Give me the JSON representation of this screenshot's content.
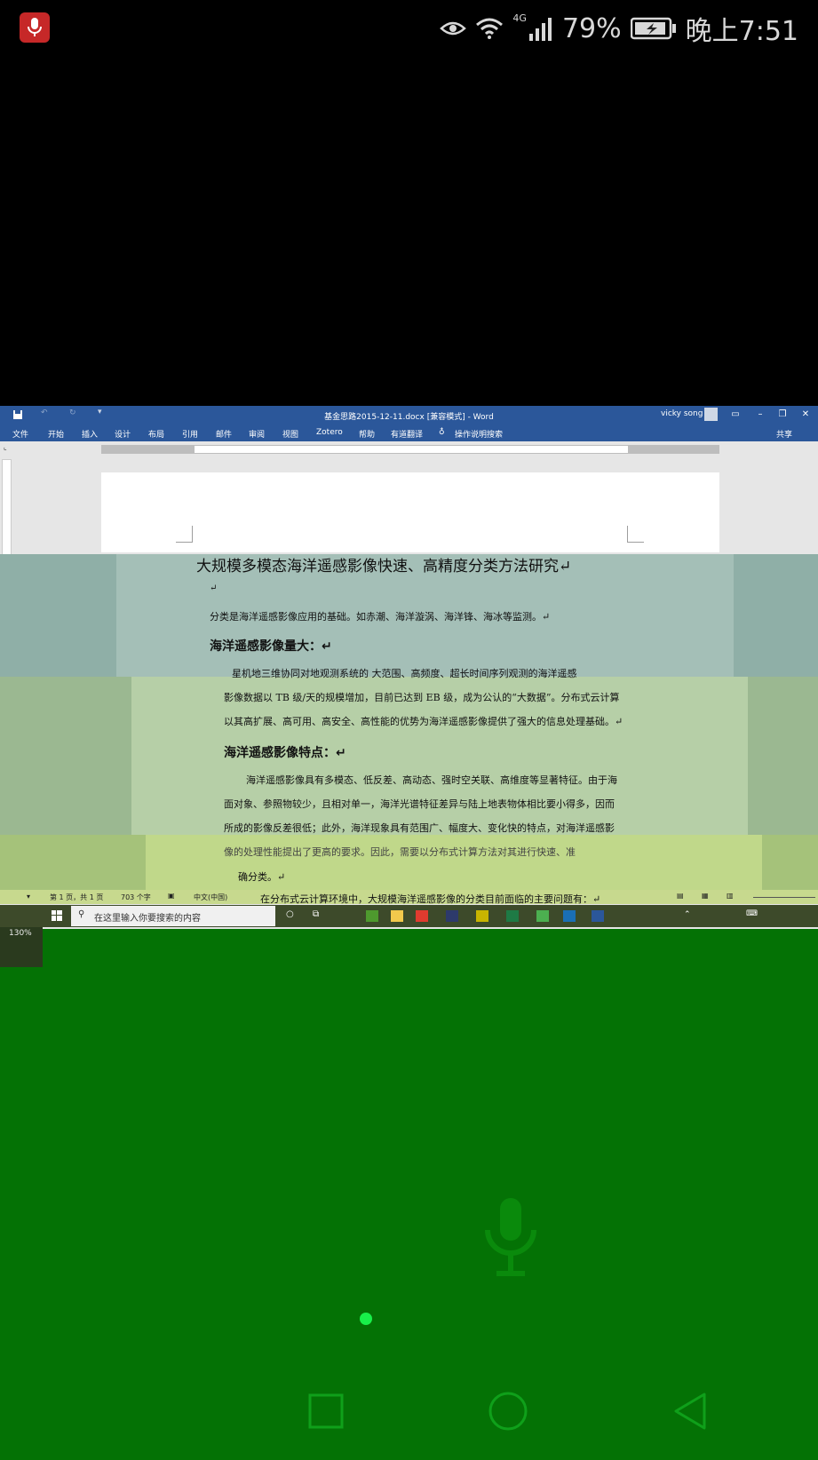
{
  "status_bar": {
    "battery": "79%",
    "time": "晚上7:51",
    "network": "4G"
  },
  "word": {
    "title": "基金思路2015-12-11.docx [兼容模式] - Word",
    "user": "vicky song",
    "menu": [
      "文件",
      "开始",
      "插入",
      "设计",
      "布局",
      "引用",
      "邮件",
      "审阅",
      "视图",
      "Zotero",
      "帮助",
      "有道翻译",
      "操作说明搜索",
      "共享"
    ],
    "document": {
      "heading": "大规模多模态海洋遥感影像快速、高精度分类方法研究↵",
      "empty_mark": "↵",
      "p1": "分类是海洋遥感影像应用的基础。如赤潮、海洋漩涡、海洋锋、海冰等监测。↵",
      "h2a": "海洋遥感影像量大：↵",
      "p2_lines": [
        "星机地三维协同对地观测系统的  大范围、高频度、超长时间序列观测的海洋遥感",
        "影像数据以 TB 级/天的规模增加，目前已达到 EB 级，成为公认的“大数据”。分布式云计算",
        "以其高扩展、高可用、高安全、高性能的优势为海洋遥感影像提供了强大的信息处理基础。↵"
      ],
      "h2b": "海洋遥感影像特点：↵",
      "p3_lines": [
        "海洋遥感影像具有多模态、低反差、高动态、强时空关联、高维度等显著特征。由于海",
        "面对象、参照物较少，且相对单一，海洋光谱特征差异与陆上地表物体相比要小得多，因而",
        "所成的影像反差很低；此外，海洋现象具有范围广、幅度大、变化快的特点，对海洋遥感影",
        "像的处理性能提出了更高的要求。因此，需要以分布式计算方法对其进行快速、准",
        "确分类。↵"
      ],
      "p4": "在分布式云计算环境中，大规模海洋遥感影像的分类目前面临的主要问题有：↵"
    },
    "status": {
      "page": "第 1 页，共 1 页",
      "words": "703 个字",
      "language": "中文(中国)"
    },
    "zoom": "130%",
    "taskbar_search": "在这里输入你要搜索的内容"
  },
  "icons": [
    "microphone-icon",
    "eye-icon",
    "wifi-icon",
    "signal-icon",
    "battery-icon",
    "save-icon",
    "undo-icon",
    "redo-icon",
    "user-icon",
    "minimize-icon",
    "restore-icon",
    "close-icon",
    "lightbulb-icon",
    "windows-icon",
    "search-icon",
    "square-icon",
    "circle-icon",
    "triangle-icon"
  ],
  "colors": {
    "word_blue": "#2b579a",
    "overlay_green": "#047205",
    "rec_red": "#c62828"
  }
}
